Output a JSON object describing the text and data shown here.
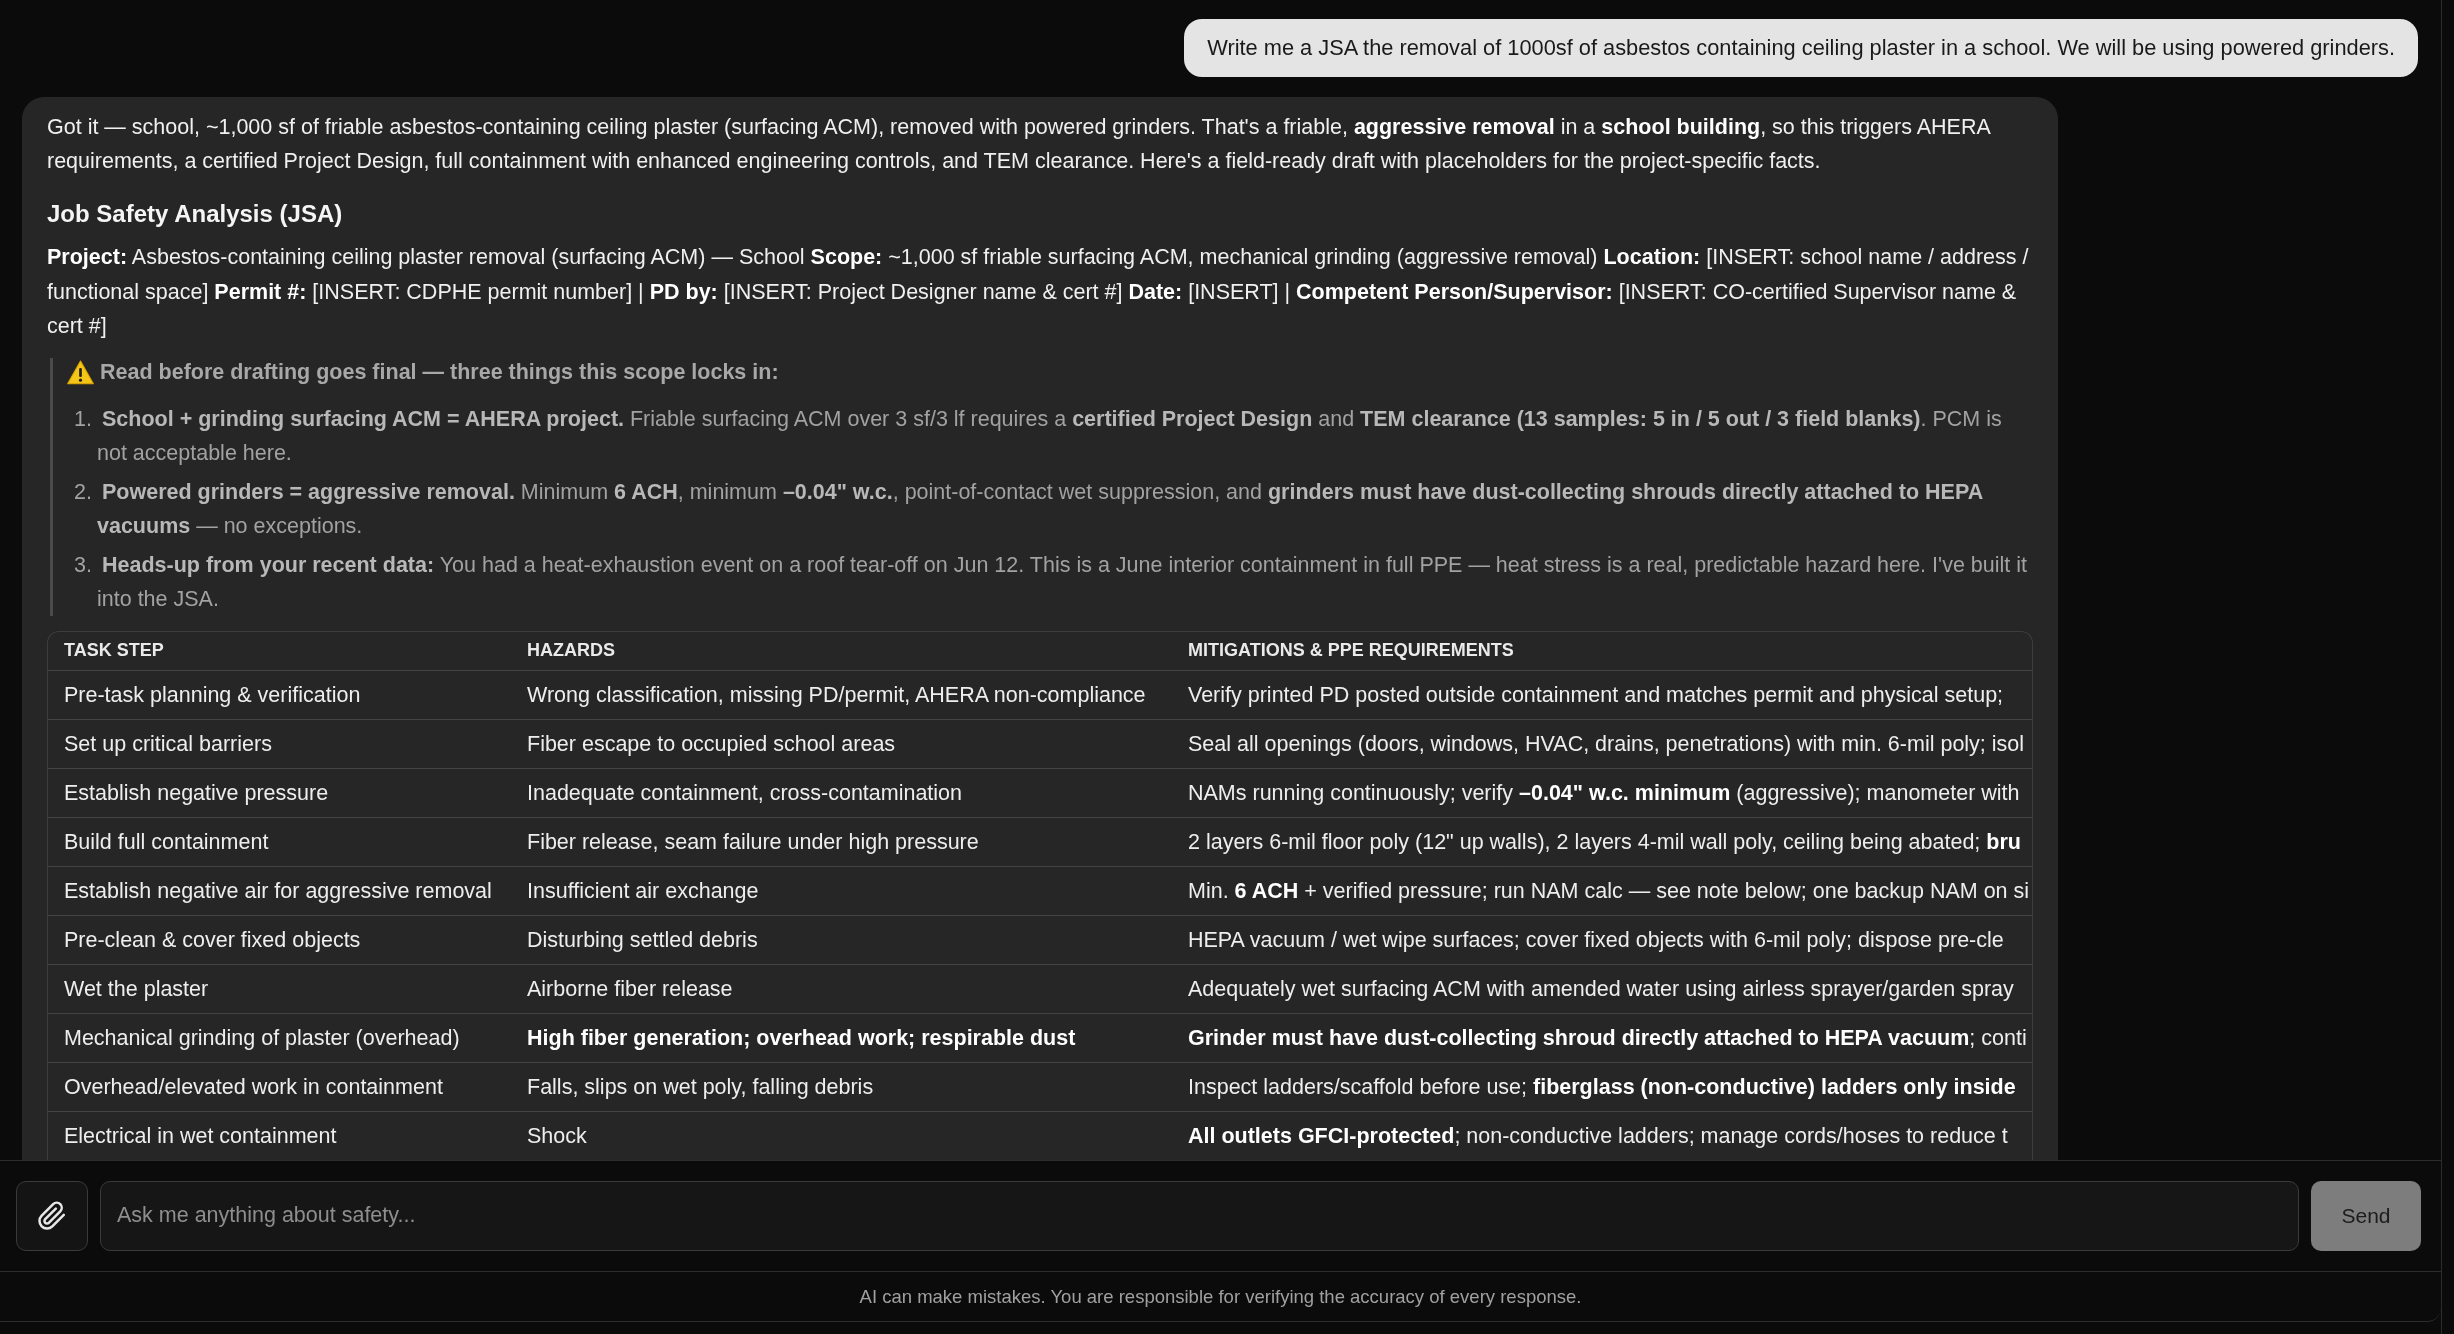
{
  "user_message": {
    "text": "Write me a JSA the removal of 1000sf of asbestos containing ceiling plaster in a school. We will be using powered grinders."
  },
  "assistant_message": {
    "intro": "Got it — school, ~1,000 sf of friable asbestos-containing ceiling plaster (surfacing ACM), removed with powered grinders. That's a friable, **aggressive removal** in a **school building**, so this triggers AHERA requirements, a certified Project Design, full containment with enhanced engineering controls, and TEM clearance. Here's a field-ready draft with placeholders for the project-specific facts.",
    "heading": "Job Safety Analysis (JSA)",
    "project_details": "**Project:** Asbestos-containing ceiling plaster removal (surfacing ACM) — School **Scope:** ~1,000 sf friable surfacing ACM, mechanical grinding (aggressive removal) **Location:** [INSERT: school name / address / functional space] **Permit #:** [INSERT: CDPHE permit number] | **PD by:** [INSERT: Project Designer name & cert #] **Date:** [INSERT] | **Competent Person/Supervisor:** [INSERT: CO-certified Supervisor name & cert #]",
    "callout": {
      "title": "Read before drafting goes final — three things this scope locks in:",
      "items": [
        {
          "number": "1.",
          "text": "**School + grinding surfacing ACM = AHERA project.** Friable surfacing ACM over 3 sf/3 lf requires a **certified Project Design** and **TEM clearance (13 samples: 5 in / 5 out / 3 field blanks)**. PCM is not acceptable here."
        },
        {
          "number": "2.",
          "text": "**Powered grinders = aggressive removal.** Minimum **6 ACH**, minimum **–0.04\" w.c.**, point-of-contact wet suppression, and **grinders must have dust-collecting shrouds directly attached to HEPA vacuums** — no exceptions."
        },
        {
          "number": "3.",
          "text": "**Heads-up from your recent data:** You had a heat-exhaustion event on a roof tear-off on Jun 12. This is a June interior containment in full PPE — heat stress is a real, predictable hazard here. I've built it into the JSA."
        }
      ]
    },
    "table": {
      "columns": [
        "TASK STEP",
        "HAZARDS",
        "MITIGATIONS & PPE REQUIREMENTS"
      ],
      "rows": [
        {
          "task_step": "Pre-task planning & verification",
          "hazards": "Wrong classification, missing PD/permit, AHERA non-compliance",
          "hazards_bold": false,
          "mitigations": "Verify printed PD posted outside containment and matches permit and physical setup;"
        },
        {
          "task_step": "Set up critical barriers",
          "hazards": "Fiber escape to occupied school areas",
          "hazards_bold": false,
          "mitigations": "Seal all openings (doors, windows, HVAC, drains, penetrations) with min. 6-mil poly; isol"
        },
        {
          "task_step": "Establish negative pressure",
          "hazards": "Inadequate containment, cross-contamination",
          "hazards_bold": false,
          "mitigations": "NAMs running continuously; verify **–0.04\" w.c. minimum** (aggressive); manometer with"
        },
        {
          "task_step": "Build full containment",
          "hazards": "Fiber release, seam failure under high pressure",
          "hazards_bold": false,
          "mitigations": "2 layers 6-mil floor poly (12\" up walls), 2 layers 4-mil wall poly, ceiling being abated; **bru**"
        },
        {
          "task_step": "Establish negative air for aggressive removal",
          "hazards": "Insufficient air exchange",
          "hazards_bold": false,
          "mitigations": "Min. **6 ACH** + verified pressure; run NAM calc — see note below; one backup NAM on si"
        },
        {
          "task_step": "Pre-clean & cover fixed objects",
          "hazards": "Disturbing settled debris",
          "hazards_bold": false,
          "mitigations": "HEPA vacuum / wet wipe surfaces; cover fixed objects with 6-mil poly; dispose pre-cle"
        },
        {
          "task_step": "Wet the plaster",
          "hazards": "Airborne fiber release",
          "hazards_bold": false,
          "mitigations": "Adequately wet surfacing ACM with amended water using airless sprayer/garden spray"
        },
        {
          "task_step": "Mechanical grinding of plaster (overhead)",
          "hazards": "High fiber generation; overhead work; respirable dust",
          "hazards_bold": true,
          "mitigations": "**Grinder must have dust-collecting shroud directly attached to HEPA vacuum**; conti"
        },
        {
          "task_step": "Overhead/elevated work in containment",
          "hazards": "Falls, slips on wet poly, falling debris",
          "hazards_bold": false,
          "mitigations": "Inspect ladders/scaffold before use; **fiberglass (non-conductive) ladders only inside**"
        },
        {
          "task_step": "Electrical in wet containment",
          "hazards": "Shock",
          "hazards_bold": false,
          "mitigations": "**All outlets GFCI-protected**; non-conductive ladders; manage cords/hoses to reduce t"
        }
      ]
    }
  },
  "composer": {
    "placeholder": "Ask me anything about safety...",
    "send_label": "Send"
  },
  "disclaimer": "AI can make mistakes. You are responsible for verifying the accuracy of every response."
}
